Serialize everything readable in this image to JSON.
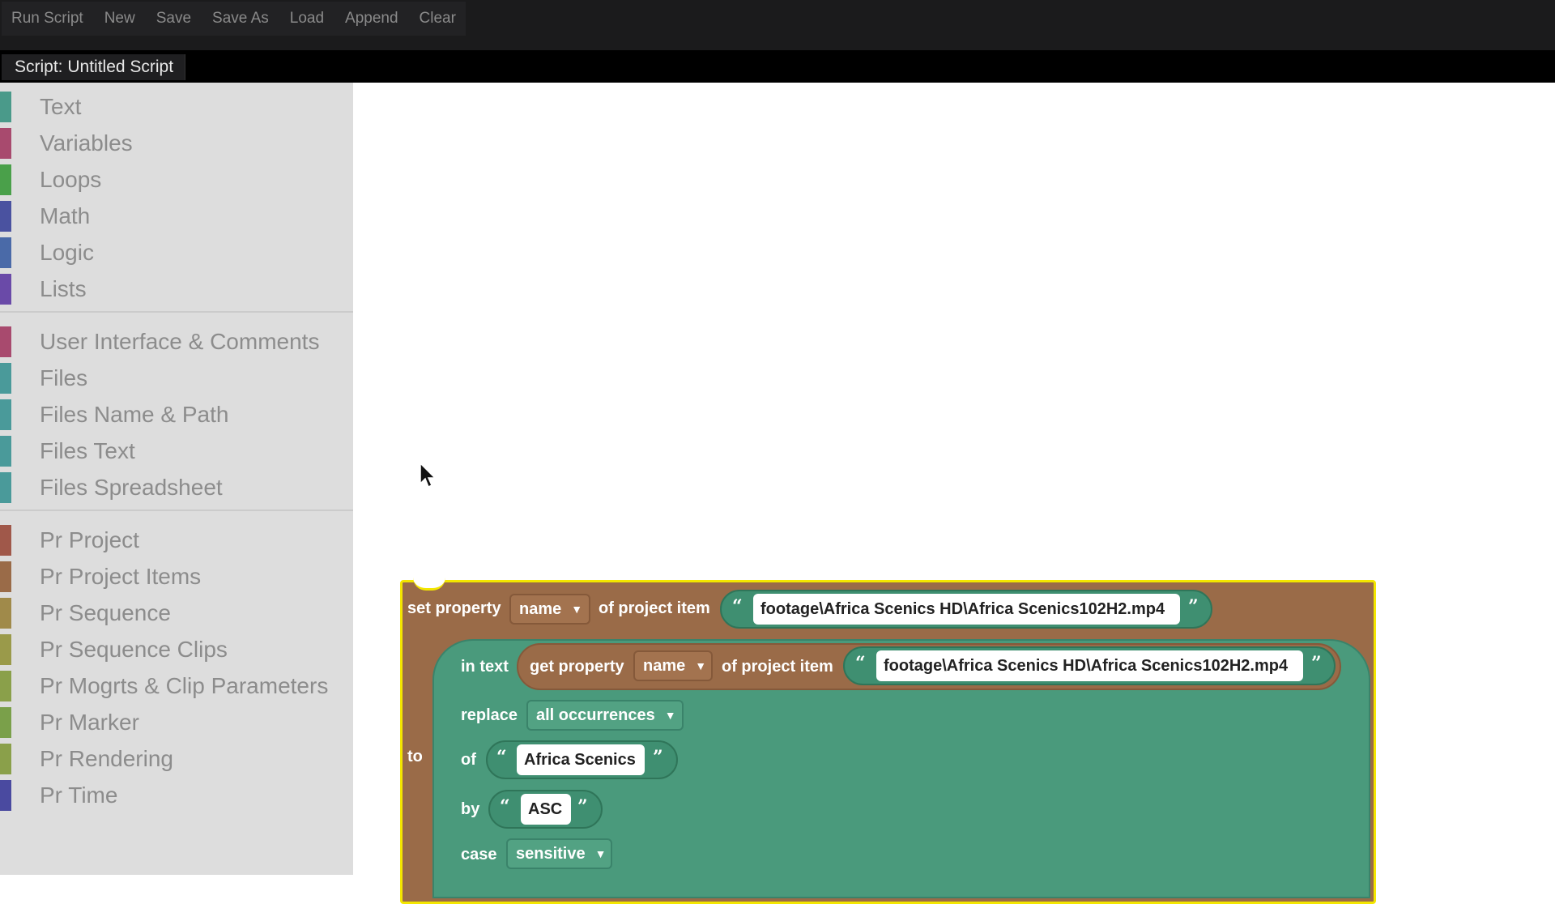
{
  "menu": {
    "items": [
      "Run Script",
      "New",
      "Save",
      "Save As",
      "Load",
      "Append",
      "Clear"
    ]
  },
  "script_tab": {
    "label": "Script: Untitled Script"
  },
  "toolbox": {
    "groups": [
      [
        {
          "label": "Text",
          "color": "#4a9a8a"
        },
        {
          "label": "Variables",
          "color": "#a84a6e"
        },
        {
          "label": "Loops",
          "color": "#4aa04a"
        },
        {
          "label": "Math",
          "color": "#4a52a0"
        },
        {
          "label": "Logic",
          "color": "#4a6aa8"
        },
        {
          "label": "Lists",
          "color": "#6a4aa8"
        }
      ],
      [
        {
          "label": "User Interface & Comments",
          "color": "#a84a6e"
        },
        {
          "label": "Files",
          "color": "#4a9a9a"
        },
        {
          "label": "Files Name & Path",
          "color": "#4a9a9a"
        },
        {
          "label": "Files Text",
          "color": "#4a9a9a"
        },
        {
          "label": "Files Spreadsheet",
          "color": "#4a9a9a"
        }
      ],
      [
        {
          "label": "Pr Project",
          "color": "#a0584a"
        },
        {
          "label": "Pr Project Items",
          "color": "#9a6b48"
        },
        {
          "label": "Pr Sequence",
          "color": "#a08a4a"
        },
        {
          "label": "Pr Sequence Clips",
          "color": "#9a9a4a"
        },
        {
          "label": "Pr Mogrts & Clip Parameters",
          "color": "#8aa04a"
        },
        {
          "label": "Pr Marker",
          "color": "#7aa04a"
        },
        {
          "label": "Pr Rendering",
          "color": "#8aa04a"
        },
        {
          "label": "Pr Time",
          "color": "#4a4aa0"
        }
      ]
    ]
  },
  "block": {
    "set_property": "set property",
    "property_value": "name",
    "of_project_item": "of project item",
    "path": "footage\\Africa Scenics HD\\Africa Scenics102H2.mp4",
    "to": "to",
    "in_text": "in text",
    "get_property": "get property",
    "get_property_value": "name",
    "get_of_project_item": "of project item",
    "get_path": "footage\\Africa Scenics HD\\Africa Scenics102H2.mp4",
    "replace": "replace",
    "replace_value": "all occurrences",
    "of": "of",
    "of_value": "Africa Scenics",
    "by": "by",
    "by_value": "ASC",
    "case": "case",
    "case_value": "sensitive",
    "open_quote": "“",
    "close_quote": "”"
  }
}
